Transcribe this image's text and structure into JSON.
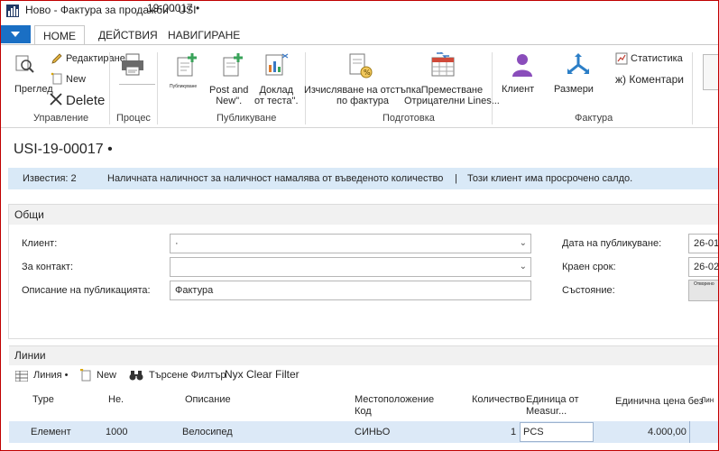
{
  "window": {
    "title": "Ново - Фактура за продажби - USI",
    "title_extra": "19-00017 •"
  },
  "tabs": [
    {
      "label": "HOME"
    },
    {
      "label": "ДЕЙСТВИЯ"
    },
    {
      "label": "НАВИГИРАНЕ"
    }
  ],
  "ribbon": {
    "view": "Преглед",
    "edit": "Редактиране",
    "new": "New",
    "delete": "Delete",
    "print_label": "",
    "small_caption": "Публикуване",
    "post_and_new": "Post and\nNew\".",
    "test_report": "Доклад\nот теста\".",
    "calc_discount": "Изчисляване на отстъпка\nпо фактура",
    "move_neg_lines": "Преместване\nОтрицателни Lines...",
    "customer": "Клиент",
    "dimensions": "Размери",
    "statistics": "Статистика",
    "comments": "ж) Коментари",
    "groups": {
      "manage": "Управление",
      "process": "Процес",
      "posting": "Публикуване",
      "prepare": "Подготовка",
      "invoice": "Фактура"
    }
  },
  "page_title": "USI-19-00017 •",
  "notifications": {
    "count_label": "Известия: 2",
    "message1": "Наличната наличност за наличност намалява от въведеното количество",
    "divider": "|",
    "message2": "Този клиент има просрочено салдо."
  },
  "general": {
    "title": "Общи",
    "customer_label": "Клиент:",
    "customer_value": "·",
    "contact_label": "За контакт:",
    "contact_value": "",
    "posting_desc_label": "Описание на публикацията:",
    "posting_desc_value": "Фактура",
    "posting_date_label": "Дата на публикуване:",
    "posting_date_value": "26-01",
    "due_date_label": "Краен срок:",
    "due_date_value": "26-02",
    "status_label": "Състояние:",
    "status_value": "Отворено"
  },
  "lines": {
    "title": "Линии",
    "toolbar": {
      "line_menu": "Линия •",
      "new": "New",
      "filter": "Търсене Филтър",
      "clear_filter": "Nyx Clear Filter"
    },
    "columns": {
      "type": "Type",
      "no": "Не.",
      "description": "Описание",
      "location": "Местоположение\nКод",
      "quantity": "Количество",
      "uom": "Единица от\nMeasur...",
      "unit_price": "Единична цена без",
      "line_amount": "Лин"
    },
    "rows": [
      {
        "type": "Елемент",
        "no": "1000",
        "description": "Велосипед",
        "location": "СИНЬО",
        "quantity": "1",
        "uom": "PCS",
        "unit_price": "4.000,00"
      }
    ]
  },
  "colors": {
    "accent_blue": "#1a6fc4",
    "notification_bg": "#d9e9f7",
    "selected_row_bg": "#dce9f7",
    "window_border": "#c00000"
  }
}
